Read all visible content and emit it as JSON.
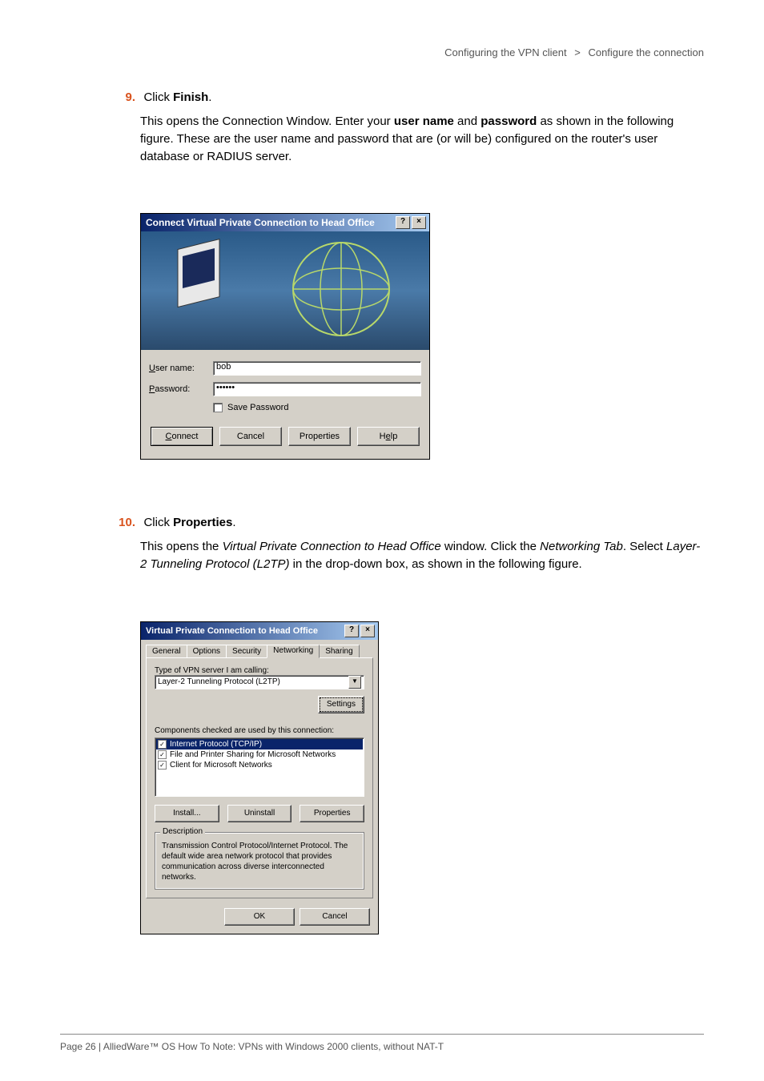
{
  "header": {
    "left": "Configuring the VPN client",
    "sep": ">",
    "right": "Configure the connection"
  },
  "step9": {
    "num": "9.",
    "action_pre": "Click ",
    "action_bold": "Finish",
    "action_post": ".",
    "body_1": "This opens the Connection Window. Enter your ",
    "body_bold1": "user name",
    "body_2": " and ",
    "body_bold2": "password",
    "body_3": " as shown in the following figure.  These are the user name and password that are (or will be) configured on the router's user database or RADIUS server."
  },
  "dialog1": {
    "title": "Connect Virtual Private Connection to Head Office",
    "username_label_u": "U",
    "username_label_rest": "ser name:",
    "username_value": "bob",
    "password_label_u": "P",
    "password_label_rest": "assword:",
    "password_value": "••••••",
    "save_pw_u": "S",
    "save_pw_rest": "ave Password",
    "btn_connect_u": "C",
    "btn_connect_rest": "onnect",
    "btn_cancel": "Cancel",
    "btn_properties": "Properties",
    "btn_help_rest_before": "H",
    "btn_help_u": "e",
    "btn_help_rest_after": "lp"
  },
  "step10": {
    "num": "10.",
    "action_pre": "Click ",
    "action_bold": "Properties",
    "action_post": ".",
    "body_1": "This opens the ",
    "body_it1": "Virtual Private Connection to Head Office",
    "body_2": " window. Click the ",
    "body_it2": "Networking Tab",
    "body_3": ". Select ",
    "body_it3": "Layer-2 Tunneling Protocol (L2TP)",
    "body_4": " in the drop-down box, as shown in the following figure."
  },
  "dialog2": {
    "title": "Virtual Private Connection to Head Office",
    "tabs": [
      "General",
      "Options",
      "Security",
      "Networking",
      "Sharing"
    ],
    "type_label_u": "T",
    "type_label_rest": "ype of VPN server I am calling:",
    "type_value": "Layer-2 Tunneling Protocol (L2TP)",
    "settings_u": "S",
    "settings_rest": "ettings",
    "components_u": "C",
    "components_rest": "omponents checked are used by this connection:",
    "list": [
      "Internet Protocol (TCP/IP)",
      "File and Printer Sharing for Microsoft Networks",
      "Client for Microsoft Networks"
    ],
    "btn_install_u": "I",
    "btn_install_rest": "nstall...",
    "btn_uninstall_u": "U",
    "btn_uninstall_rest": "ninstall",
    "btn_props_u": "r",
    "btn_props_before": "P",
    "btn_props_after": "operties",
    "desc_title": "Description",
    "desc_text": "Transmission Control Protocol/Internet Protocol. The default wide area network protocol that provides communication across diverse interconnected networks.",
    "btn_ok": "OK",
    "btn_cancel": "Cancel"
  },
  "footer": "Page 26 | AlliedWare™ OS How To Note: VPNs with Windows 2000 clients, without NAT-T"
}
